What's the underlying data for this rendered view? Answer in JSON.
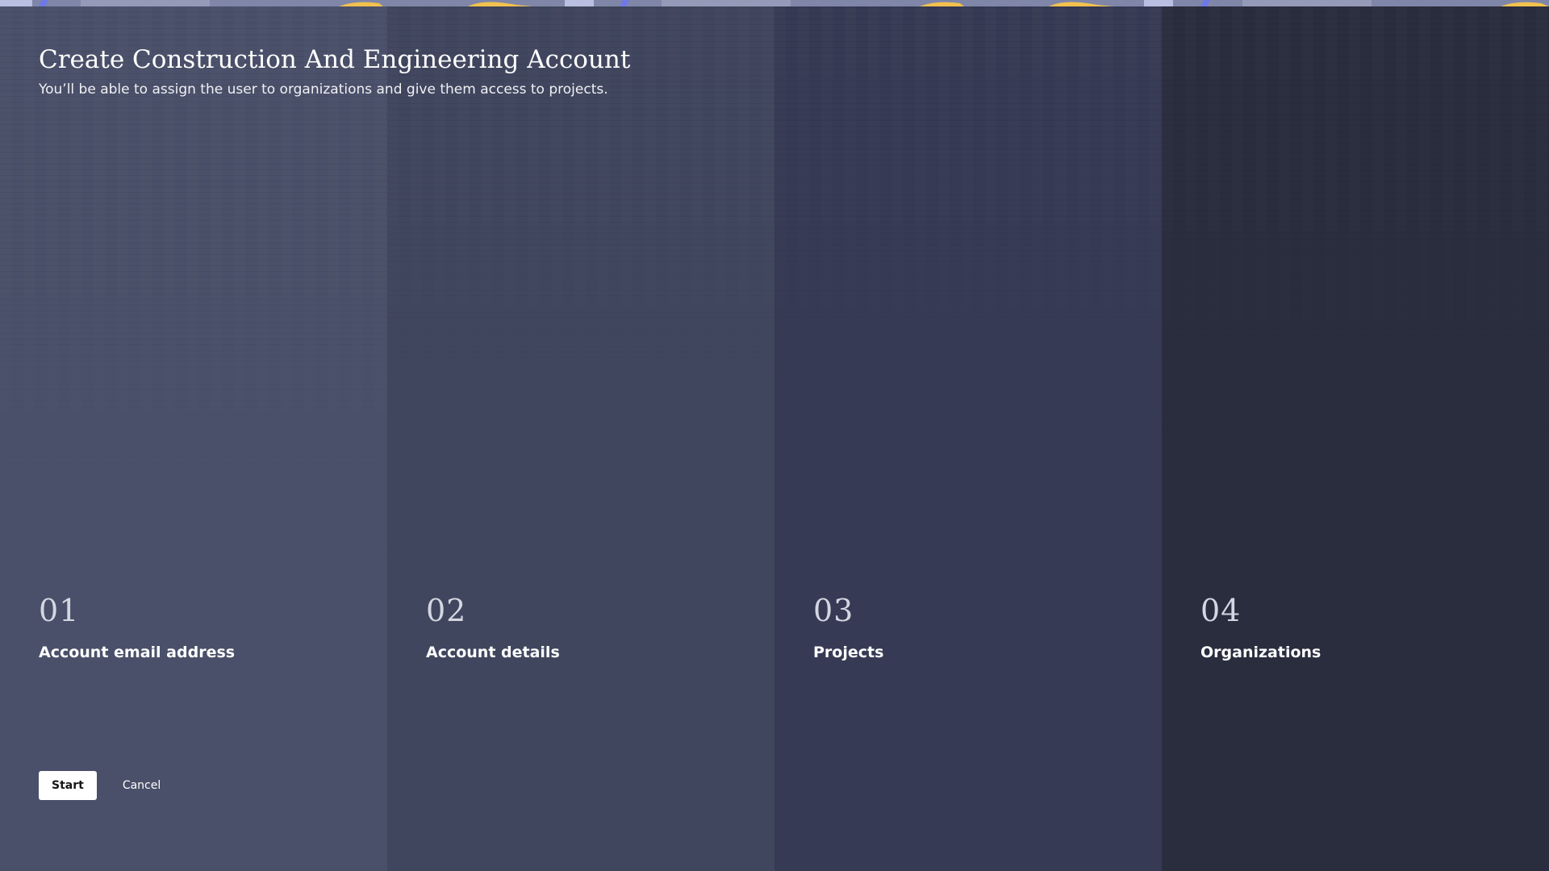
{
  "page": {
    "title": "Create Construction And Engineering Account",
    "subtitle": "You’ll be able to assign the user to organizations and give them access to projects."
  },
  "steps": [
    {
      "number": "01",
      "title": "Account email address"
    },
    {
      "number": "02",
      "title": "Account details"
    },
    {
      "number": "03",
      "title": "Projects"
    },
    {
      "number": "04",
      "title": "Organizations"
    }
  ],
  "actions": {
    "start_label": "Start",
    "cancel_label": "Cancel"
  },
  "colors": {
    "column_1": "#4a5069",
    "column_2": "#40465e",
    "column_3": "#363a54",
    "column_4": "#2a2d3e",
    "strip_accent_yellow": "#f2c14e",
    "strip_accent_blue": "#6e78e6"
  }
}
